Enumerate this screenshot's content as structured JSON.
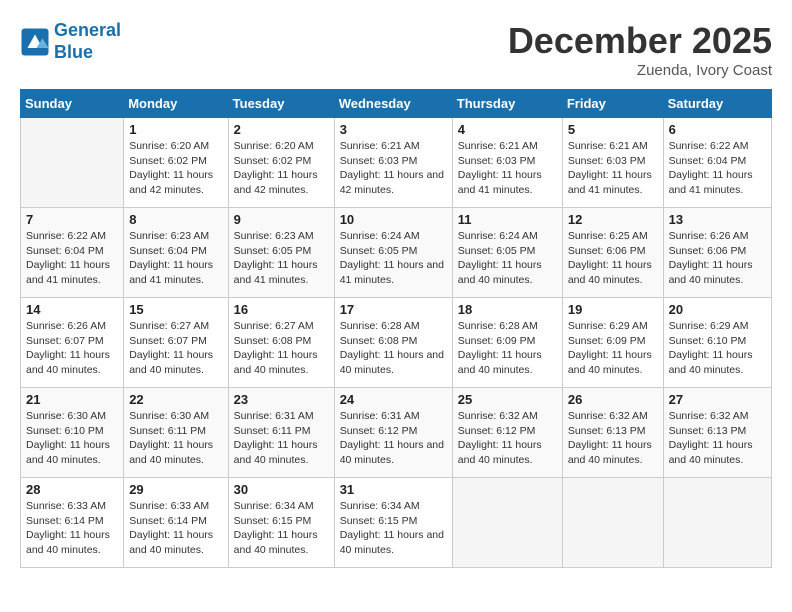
{
  "header": {
    "logo_line1": "General",
    "logo_line2": "Blue",
    "month": "December 2025",
    "location": "Zuenda, Ivory Coast"
  },
  "weekdays": [
    "Sunday",
    "Monday",
    "Tuesday",
    "Wednesday",
    "Thursday",
    "Friday",
    "Saturday"
  ],
  "weeks": [
    [
      {
        "day": "",
        "sunrise": "",
        "sunset": "",
        "daylight": ""
      },
      {
        "day": "1",
        "sunrise": "Sunrise: 6:20 AM",
        "sunset": "Sunset: 6:02 PM",
        "daylight": "Daylight: 11 hours and 42 minutes."
      },
      {
        "day": "2",
        "sunrise": "Sunrise: 6:20 AM",
        "sunset": "Sunset: 6:02 PM",
        "daylight": "Daylight: 11 hours and 42 minutes."
      },
      {
        "day": "3",
        "sunrise": "Sunrise: 6:21 AM",
        "sunset": "Sunset: 6:03 PM",
        "daylight": "Daylight: 11 hours and 42 minutes."
      },
      {
        "day": "4",
        "sunrise": "Sunrise: 6:21 AM",
        "sunset": "Sunset: 6:03 PM",
        "daylight": "Daylight: 11 hours and 41 minutes."
      },
      {
        "day": "5",
        "sunrise": "Sunrise: 6:21 AM",
        "sunset": "Sunset: 6:03 PM",
        "daylight": "Daylight: 11 hours and 41 minutes."
      },
      {
        "day": "6",
        "sunrise": "Sunrise: 6:22 AM",
        "sunset": "Sunset: 6:04 PM",
        "daylight": "Daylight: 11 hours and 41 minutes."
      }
    ],
    [
      {
        "day": "7",
        "sunrise": "Sunrise: 6:22 AM",
        "sunset": "Sunset: 6:04 PM",
        "daylight": "Daylight: 11 hours and 41 minutes."
      },
      {
        "day": "8",
        "sunrise": "Sunrise: 6:23 AM",
        "sunset": "Sunset: 6:04 PM",
        "daylight": "Daylight: 11 hours and 41 minutes."
      },
      {
        "day": "9",
        "sunrise": "Sunrise: 6:23 AM",
        "sunset": "Sunset: 6:05 PM",
        "daylight": "Daylight: 11 hours and 41 minutes."
      },
      {
        "day": "10",
        "sunrise": "Sunrise: 6:24 AM",
        "sunset": "Sunset: 6:05 PM",
        "daylight": "Daylight: 11 hours and 41 minutes."
      },
      {
        "day": "11",
        "sunrise": "Sunrise: 6:24 AM",
        "sunset": "Sunset: 6:05 PM",
        "daylight": "Daylight: 11 hours and 40 minutes."
      },
      {
        "day": "12",
        "sunrise": "Sunrise: 6:25 AM",
        "sunset": "Sunset: 6:06 PM",
        "daylight": "Daylight: 11 hours and 40 minutes."
      },
      {
        "day": "13",
        "sunrise": "Sunrise: 6:26 AM",
        "sunset": "Sunset: 6:06 PM",
        "daylight": "Daylight: 11 hours and 40 minutes."
      }
    ],
    [
      {
        "day": "14",
        "sunrise": "Sunrise: 6:26 AM",
        "sunset": "Sunset: 6:07 PM",
        "daylight": "Daylight: 11 hours and 40 minutes."
      },
      {
        "day": "15",
        "sunrise": "Sunrise: 6:27 AM",
        "sunset": "Sunset: 6:07 PM",
        "daylight": "Daylight: 11 hours and 40 minutes."
      },
      {
        "day": "16",
        "sunrise": "Sunrise: 6:27 AM",
        "sunset": "Sunset: 6:08 PM",
        "daylight": "Daylight: 11 hours and 40 minutes."
      },
      {
        "day": "17",
        "sunrise": "Sunrise: 6:28 AM",
        "sunset": "Sunset: 6:08 PM",
        "daylight": "Daylight: 11 hours and 40 minutes."
      },
      {
        "day": "18",
        "sunrise": "Sunrise: 6:28 AM",
        "sunset": "Sunset: 6:09 PM",
        "daylight": "Daylight: 11 hours and 40 minutes."
      },
      {
        "day": "19",
        "sunrise": "Sunrise: 6:29 AM",
        "sunset": "Sunset: 6:09 PM",
        "daylight": "Daylight: 11 hours and 40 minutes."
      },
      {
        "day": "20",
        "sunrise": "Sunrise: 6:29 AM",
        "sunset": "Sunset: 6:10 PM",
        "daylight": "Daylight: 11 hours and 40 minutes."
      }
    ],
    [
      {
        "day": "21",
        "sunrise": "Sunrise: 6:30 AM",
        "sunset": "Sunset: 6:10 PM",
        "daylight": "Daylight: 11 hours and 40 minutes."
      },
      {
        "day": "22",
        "sunrise": "Sunrise: 6:30 AM",
        "sunset": "Sunset: 6:11 PM",
        "daylight": "Daylight: 11 hours and 40 minutes."
      },
      {
        "day": "23",
        "sunrise": "Sunrise: 6:31 AM",
        "sunset": "Sunset: 6:11 PM",
        "daylight": "Daylight: 11 hours and 40 minutes."
      },
      {
        "day": "24",
        "sunrise": "Sunrise: 6:31 AM",
        "sunset": "Sunset: 6:12 PM",
        "daylight": "Daylight: 11 hours and 40 minutes."
      },
      {
        "day": "25",
        "sunrise": "Sunrise: 6:32 AM",
        "sunset": "Sunset: 6:12 PM",
        "daylight": "Daylight: 11 hours and 40 minutes."
      },
      {
        "day": "26",
        "sunrise": "Sunrise: 6:32 AM",
        "sunset": "Sunset: 6:13 PM",
        "daylight": "Daylight: 11 hours and 40 minutes."
      },
      {
        "day": "27",
        "sunrise": "Sunrise: 6:32 AM",
        "sunset": "Sunset: 6:13 PM",
        "daylight": "Daylight: 11 hours and 40 minutes."
      }
    ],
    [
      {
        "day": "28",
        "sunrise": "Sunrise: 6:33 AM",
        "sunset": "Sunset: 6:14 PM",
        "daylight": "Daylight: 11 hours and 40 minutes."
      },
      {
        "day": "29",
        "sunrise": "Sunrise: 6:33 AM",
        "sunset": "Sunset: 6:14 PM",
        "daylight": "Daylight: 11 hours and 40 minutes."
      },
      {
        "day": "30",
        "sunrise": "Sunrise: 6:34 AM",
        "sunset": "Sunset: 6:15 PM",
        "daylight": "Daylight: 11 hours and 40 minutes."
      },
      {
        "day": "31",
        "sunrise": "Sunrise: 6:34 AM",
        "sunset": "Sunset: 6:15 PM",
        "daylight": "Daylight: 11 hours and 40 minutes."
      },
      {
        "day": "",
        "sunrise": "",
        "sunset": "",
        "daylight": ""
      },
      {
        "day": "",
        "sunrise": "",
        "sunset": "",
        "daylight": ""
      },
      {
        "day": "",
        "sunrise": "",
        "sunset": "",
        "daylight": ""
      }
    ]
  ]
}
